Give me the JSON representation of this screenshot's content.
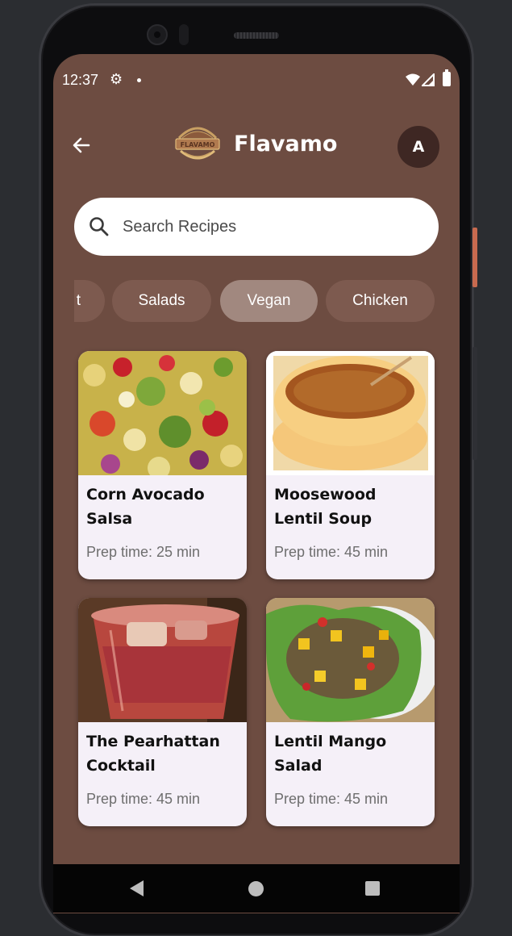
{
  "status_bar": {
    "time": "12:37",
    "icons": [
      "settings-icon",
      "notification-dot",
      "wifi-icon",
      "cellular-icon",
      "battery-icon"
    ]
  },
  "header": {
    "brand": "Flavamo",
    "logo_text": "FLAVAMO",
    "avatar_initial": "A"
  },
  "search": {
    "placeholder": "Search Recipes"
  },
  "categories": [
    {
      "label": "t",
      "selected": false
    },
    {
      "label": "Salads",
      "selected": false
    },
    {
      "label": "Vegan",
      "selected": true
    },
    {
      "label": "Chicken",
      "selected": false
    }
  ],
  "recipes": [
    {
      "title": "Corn Avocado Salsa",
      "prep": "Prep time: 25 min"
    },
    {
      "title": "Moosewood Lentil Soup",
      "prep": "Prep time: 45 min"
    },
    {
      "title": "The Pearhattan Cocktail",
      "prep": "Prep time: 45 min"
    },
    {
      "title": "Lentil Mango Salad",
      "prep": "Prep time: 45 min"
    }
  ],
  "colors": {
    "background": "#6d4c41",
    "chip": "#7d5a4f",
    "chip_selected": "#a1887f",
    "card": "#f5f0f8",
    "avatar": "#3e2723"
  }
}
